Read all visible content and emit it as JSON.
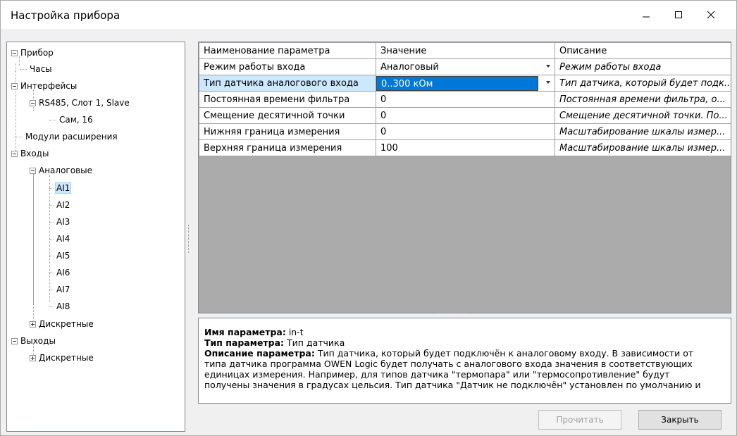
{
  "window": {
    "title": "Настройка прибора"
  },
  "tree": {
    "items": [
      {
        "label": "Прибор"
      },
      {
        "label": "Часы"
      },
      {
        "label": "Интерфейсы"
      },
      {
        "label": "RS485, Слот 1, Slave"
      },
      {
        "label": "Сам, 16"
      },
      {
        "label": "Модули расширения"
      },
      {
        "label": "Входы"
      },
      {
        "label": "Аналоговые"
      },
      {
        "label": "AI1"
      },
      {
        "label": "AI2"
      },
      {
        "label": "AI3"
      },
      {
        "label": "AI4"
      },
      {
        "label": "AI5"
      },
      {
        "label": "AI6"
      },
      {
        "label": "AI7"
      },
      {
        "label": "AI8"
      },
      {
        "label": "Дискретные"
      },
      {
        "label": "Выходы"
      },
      {
        "label": "Дискретные"
      }
    ]
  },
  "grid": {
    "headers": [
      "Наименование параметра",
      "Значение",
      "Описание"
    ],
    "rows": [
      {
        "name": "Режим работы входа",
        "value": "Аналоговый",
        "desc": "Режим работы входа"
      },
      {
        "name": "Тип датчика аналогового входа",
        "value": "0..300 кОм",
        "desc": "Тип датчика, который будет подк..."
      },
      {
        "name": "Постоянная времени фильтра",
        "value": "0",
        "desc": "Постоянная времени фильтра, о..."
      },
      {
        "name": "Смещение десятичной точки",
        "value": "0",
        "desc": "Смещение десятичной точки. По..."
      },
      {
        "name": "Нижняя граница измерения",
        "value": "0",
        "desc": "Масштабирование шкалы измер..."
      },
      {
        "name": "Верхняя граница измерения",
        "value": "100",
        "desc": "Масштабирование шкалы измер..."
      }
    ]
  },
  "details": {
    "name_label": "Имя параметра:",
    "name_value": " in-t",
    "type_label": "Тип параметра:",
    "type_value": " Тип датчика",
    "desc_label": "Описание параметра:",
    "desc_line1": " Тип датчика, который будет подключён к аналоговому входу. В зависимости от",
    "desc_line2": "типа датчика программа OWEN Logic будет получать с аналогового входа значения в соответствующих",
    "desc_line3": "единицах измерения. Например, для типов датчика \"термопара\" или \"термосопротивление\" будут",
    "desc_line4": "получены значения в градусах цельсия. Тип датчика \"Датчик не подключён\"  установлен по умолчанию и"
  },
  "buttons": {
    "read": "Прочитать",
    "close": "Закрыть"
  }
}
